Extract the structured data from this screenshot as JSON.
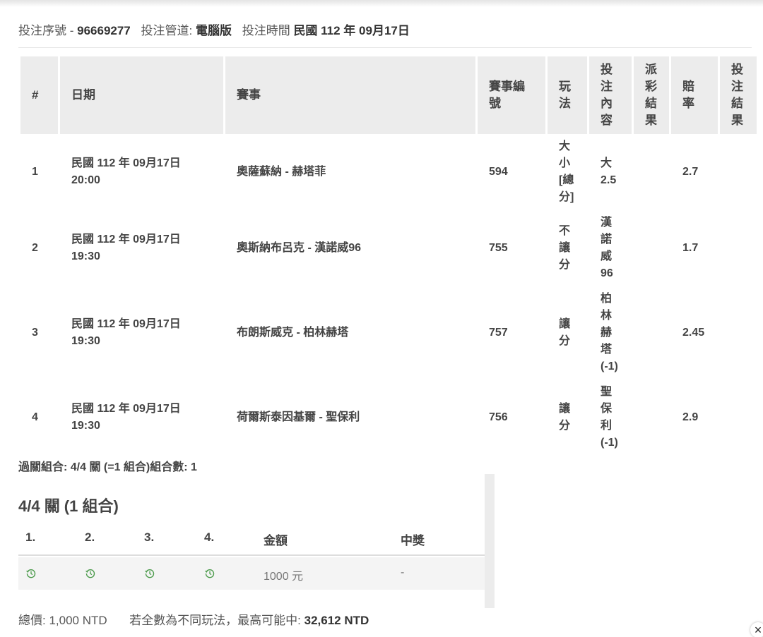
{
  "header": {
    "serial_label": "投注序號 -",
    "serial_value": "96669277",
    "channel_label": "投注管道:",
    "channel_value": "電腦版",
    "time_label": "投注時間",
    "time_value": "民國 112 年 09月17日"
  },
  "table": {
    "headers": {
      "num": "#",
      "date": "日期",
      "event": "賽事",
      "event_no": "賽事編號",
      "play": [
        "玩",
        "法"
      ],
      "content": [
        "投",
        "注",
        "內",
        "容"
      ],
      "payout": [
        "派",
        "彩",
        "結",
        "果"
      ],
      "odds": [
        "賠",
        "率"
      ],
      "result": [
        "投",
        "注",
        "結",
        "果"
      ]
    },
    "rows": [
      {
        "num": "1",
        "date": "民國 112 年 09月17日",
        "time": "20:00",
        "event": "奧薩蘇納 - 赫塔菲",
        "event_no": "594",
        "play": [
          "大",
          "小",
          "[總",
          "分]"
        ],
        "content": [
          "大",
          "2.5"
        ],
        "payout": "",
        "odds": "2.7",
        "result": ""
      },
      {
        "num": "2",
        "date": "民國 112 年 09月17日",
        "time": "19:30",
        "event": "奧斯納布呂克 - 漢諾威96",
        "event_no": "755",
        "play": [
          "不",
          "讓",
          "分"
        ],
        "content": [
          "漢",
          "諾",
          "威",
          "96"
        ],
        "payout": "",
        "odds": "1.7",
        "result": ""
      },
      {
        "num": "3",
        "date": "民國 112 年 09月17日",
        "time": "19:30",
        "event": "布朗斯威克 - 柏林赫塔",
        "event_no": "757",
        "play": [
          "讓",
          "分"
        ],
        "content": [
          "柏",
          "林",
          "赫",
          "塔",
          "(-1)"
        ],
        "payout": "",
        "odds": "2.45",
        "result": ""
      },
      {
        "num": "4",
        "date": "民國 112 年 09月17日",
        "time": "19:30",
        "event": "荷爾斯泰因基爾 - 聖保利",
        "event_no": "756",
        "play": [
          "讓",
          "分"
        ],
        "content": [
          "聖",
          "保",
          "利",
          "(-1)"
        ],
        "payout": "",
        "odds": "2.9",
        "result": ""
      }
    ]
  },
  "combo_summary": "過關組合: 4/4 關 (=1 組合)組合數: 1",
  "combo": {
    "title": "4/4 關 (1 組合)",
    "headers": [
      "1.",
      "2.",
      "3.",
      "4.",
      "金額",
      "中獎"
    ],
    "row": {
      "amount": "1000 元",
      "win": "-"
    },
    "icon_name": "pending-clock-icon",
    "icon_color": "#4a9a4a"
  },
  "footer": {
    "total_label": "總價:",
    "total_value": "1,000 NTD",
    "max_label": "若全數為不同玩法，最高可能中:",
    "max_value": "32,612 NTD"
  },
  "close_label": "×"
}
